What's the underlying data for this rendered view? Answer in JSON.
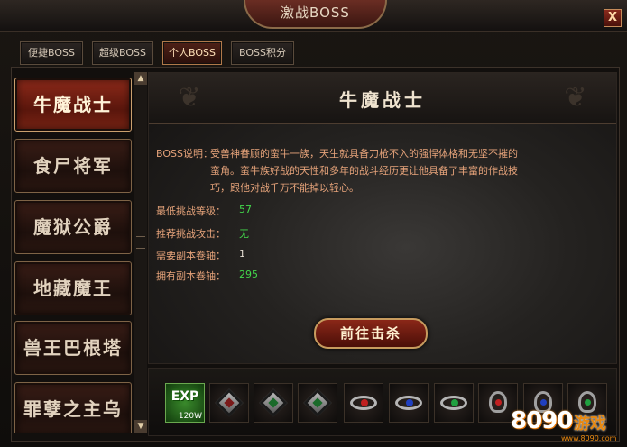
{
  "window": {
    "title": "激战BOSS",
    "close_label": "X"
  },
  "tabs": [
    {
      "label": "便捷BOSS",
      "active": false
    },
    {
      "label": "超级BOSS",
      "active": false
    },
    {
      "label": "个人BOSS",
      "active": true
    },
    {
      "label": "BOSS积分",
      "active": false
    }
  ],
  "boss_list": [
    {
      "name": "牛魔战士",
      "selected": true
    },
    {
      "name": "食尸将军",
      "selected": false
    },
    {
      "name": "魔狱公爵",
      "selected": false
    },
    {
      "name": "地藏魔王",
      "selected": false
    },
    {
      "name": "兽王巴根塔",
      "selected": false
    },
    {
      "name": "罪孽之主乌尔",
      "selected": false
    }
  ],
  "scrollbar": {
    "up_icon": "▲",
    "down_icon": "▼"
  },
  "boss_detail": {
    "title": "牛魔战士",
    "desc_label": "BOSS说明：",
    "desc_lines": [
      "受兽神眷顾的蛮牛一族，天生就具备刀枪不入的强悍体格和无坚不摧的",
      "蛮角。蛮牛族好战的天性和多年的战斗经历更让他具备了丰富的作战技",
      "巧，跟他对战千万不能掉以轻心。"
    ],
    "stats": [
      {
        "label": "最低挑战等级：",
        "value": "57",
        "color": "green"
      },
      {
        "label": "推荐挑战攻击：",
        "value": "无",
        "color": "green"
      },
      {
        "label": "需要副本卷轴：",
        "value": "1",
        "color": "white"
      },
      {
        "label": "拥有副本卷轴：",
        "value": "295",
        "color": "green"
      }
    ],
    "go_button": "前往击杀"
  },
  "rewards": {
    "exp": {
      "label": "EXP",
      "amount": "120W"
    },
    "items": [
      {
        "icon": "gem-shard-icon",
        "color": "#7a1a1a"
      },
      {
        "icon": "gem-shard-icon",
        "color": "#1a6a2a"
      },
      {
        "icon": "gem-shard-icon",
        "color": "#1a6a2a"
      },
      {
        "icon": "ring-icon",
        "color": "#c02020"
      },
      {
        "icon": "ring-icon",
        "color": "#2040c0"
      },
      {
        "icon": "ring-icon",
        "color": "#20a040"
      },
      {
        "icon": "amulet-icon",
        "color": "#c02020"
      },
      {
        "icon": "amulet-icon",
        "color": "#2040c0"
      },
      {
        "icon": "amulet-icon",
        "color": "#20a040"
      }
    ]
  },
  "watermark": {
    "number": "8090",
    "word": "游戏",
    "url": "www.8090.com"
  }
}
